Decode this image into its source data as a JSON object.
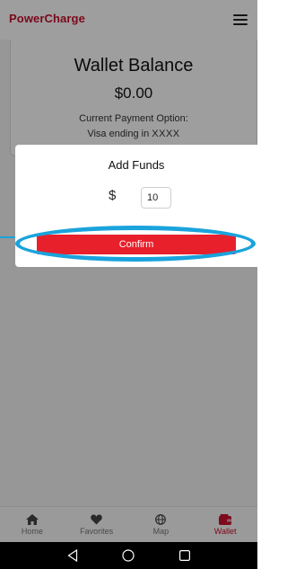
{
  "header": {
    "logo_text_p": "P",
    "logo_text_rest": "owerCharge",
    "menu_icon": "hamburger-icon"
  },
  "wallet": {
    "title": "Wallet Balance",
    "balance": "$0.00",
    "payment_option_label": "Current Payment Option:",
    "payment_prefix": "Visa ending in ",
    "payment_last4": "XXXX"
  },
  "modal": {
    "title": "Add Funds",
    "currency_symbol": "$",
    "amount_value": "10",
    "confirm_label": "Confirm"
  },
  "bottom_nav": {
    "items": [
      {
        "label": "Home",
        "icon": "home-icon",
        "active": false
      },
      {
        "label": "Favorites",
        "icon": "heart-icon",
        "active": false
      },
      {
        "label": "Map",
        "icon": "globe-icon",
        "active": false
      },
      {
        "label": "Wallet",
        "icon": "wallet-icon",
        "active": true
      }
    ]
  },
  "android_nav": {
    "icons": [
      "back-icon",
      "home-circle-icon",
      "recents-icon"
    ]
  },
  "colors": {
    "brand": "#c8102e",
    "confirm_button": "#e8202c",
    "highlight": "#1aa3dc"
  }
}
